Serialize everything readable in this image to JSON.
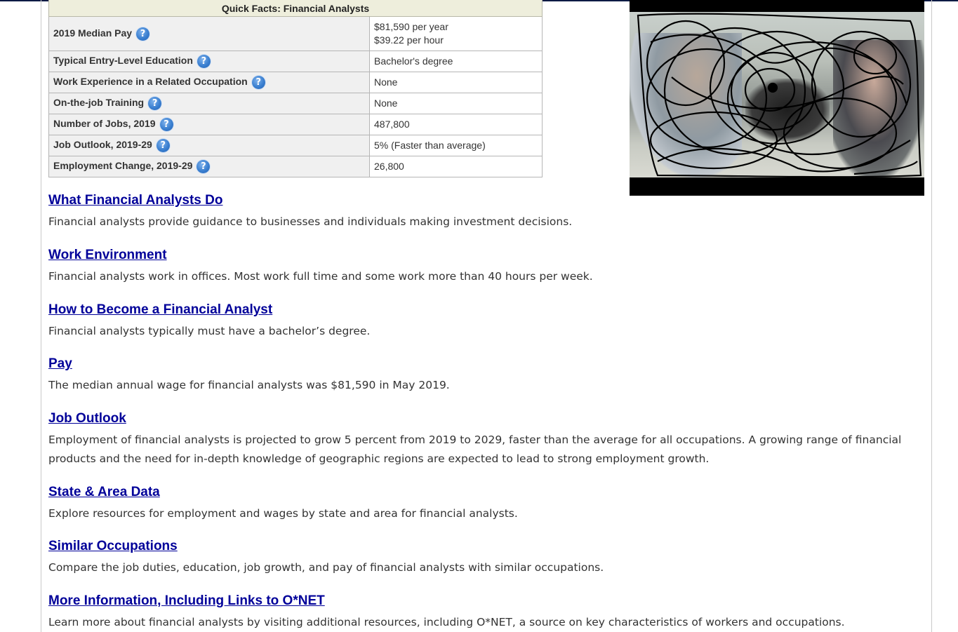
{
  "quick_facts": {
    "title": "Quick Facts: Financial Analysts",
    "rows": [
      {
        "label": "2019 Median Pay",
        "value_lines": [
          "$81,590 per year",
          "$39.22 per hour"
        ]
      },
      {
        "label": "Typical Entry-Level Education",
        "value_lines": [
          "Bachelor's degree"
        ]
      },
      {
        "label": "Work Experience in a Related Occupation",
        "value_lines": [
          "None"
        ]
      },
      {
        "label": "On-the-job Training",
        "value_lines": [
          "None"
        ]
      },
      {
        "label": "Number of Jobs, 2019",
        "value_lines": [
          "487,800"
        ]
      },
      {
        "label": "Job Outlook, 2019-29",
        "value_lines": [
          "5% (Faster than average)"
        ]
      },
      {
        "label": "Employment Change, 2019-29",
        "value_lines": [
          "26,800"
        ]
      }
    ],
    "help_icon_glyph": "?"
  },
  "video": {
    "icon": "video-thumbnail-scribbled"
  },
  "sections": [
    {
      "heading": "What Financial Analysts Do",
      "summary": "Financial analysts provide guidance to businesses and individuals making investment decisions."
    },
    {
      "heading": "Work Environment",
      "summary": "Financial analysts work in offices. Most work full time and some work more than 40 hours per week."
    },
    {
      "heading": "How to Become a Financial Analyst",
      "summary": "Financial analysts typically must have a bachelor’s degree."
    },
    {
      "heading": "Pay",
      "summary": "The median annual wage for financial analysts was $81,590 in May 2019."
    },
    {
      "heading": "Job Outlook",
      "summary": "Employment of financial analysts is projected to grow 5 percent from 2019 to 2029, faster than the average for all occupations. A growing range of financial products and the need for in-depth knowledge of geographic regions are expected to lead to strong employment growth."
    },
    {
      "heading": "State & Area Data",
      "summary": "Explore resources for employment and wages by state and area for financial analysts."
    },
    {
      "heading": "Similar Occupations",
      "summary": "Compare the job duties, education, job growth, and pay of financial analysts with similar occupations."
    },
    {
      "heading": "More Information, Including Links to O*NET",
      "summary": "Learn more about financial analysts by visiting additional resources, including O*NET, a source on key characteristics of workers and occupations."
    }
  ]
}
